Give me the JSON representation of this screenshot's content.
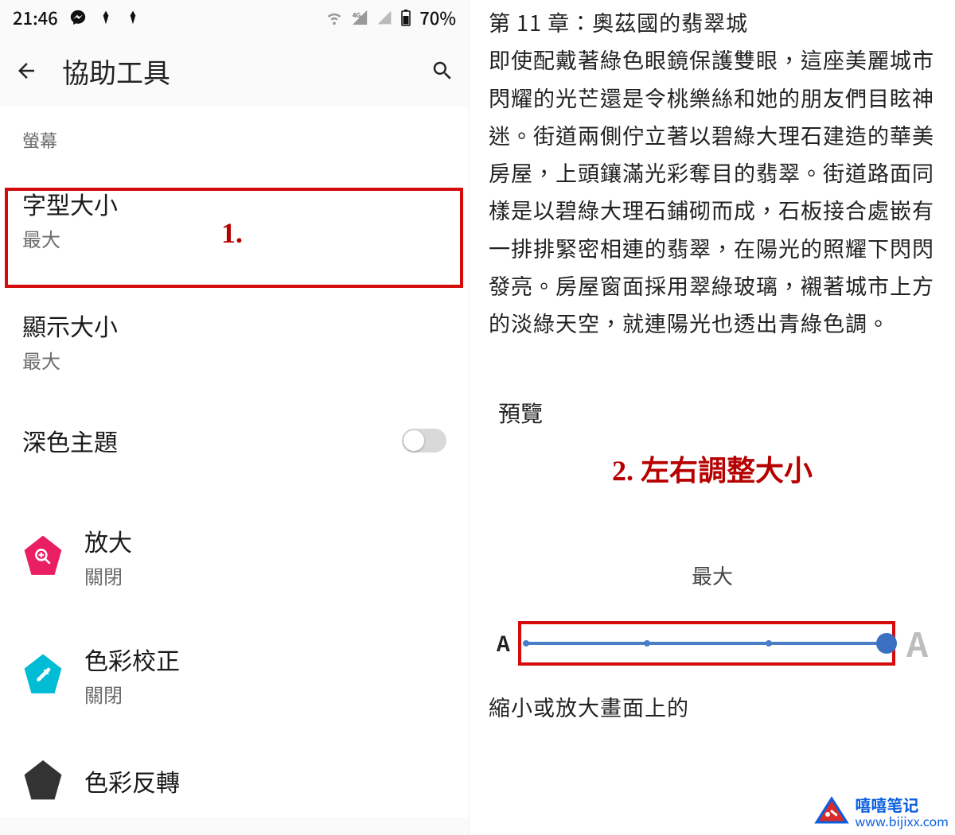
{
  "status_bar": {
    "time": "21:46",
    "battery_text": "70%"
  },
  "toolbar": {
    "title": "協助工具"
  },
  "section": {
    "screen_label": "螢幕"
  },
  "items": {
    "font_size": {
      "title": "字型大小",
      "sub": "最大"
    },
    "display_size": {
      "title": "顯示大小",
      "sub": "最大"
    },
    "dark_theme": {
      "title": "深色主題"
    },
    "magnify": {
      "title": "放大",
      "sub": "關閉"
    },
    "color_correction": {
      "title": "色彩校正",
      "sub": "關閉"
    },
    "color_invert": {
      "title": "色彩反轉"
    }
  },
  "annotations": {
    "step1": "1.",
    "step2": "2. 左右調整大小"
  },
  "preview": {
    "chapter": "第 11 章：奧茲國的翡翠城",
    "body": "即使配戴著綠色眼鏡保護雙眼，這座美麗城市閃耀的光芒還是令桃樂絲和她的朋友們目眩神迷。街道兩側佇立著以碧綠大理石建造的華美房屋，上頭鑲滿光彩奪目的翡翠。街道路面同樣是以碧綠大理石鋪砌而成，石板接合處嵌有一排排緊密相連的翡翠，在陽光的照耀下閃閃發亮。房屋窗面採用翠綠玻璃，襯著城市上方的淡綠天空，就連陽光也透出青綠色調。",
    "label": "預覽",
    "slider_state": "最大",
    "a_small": "A",
    "a_large": "A",
    "bottom_text": "縮小或放大畫面上的"
  },
  "watermark": {
    "name": "嘻嘻笔记",
    "url": "www.bijixx.com"
  }
}
